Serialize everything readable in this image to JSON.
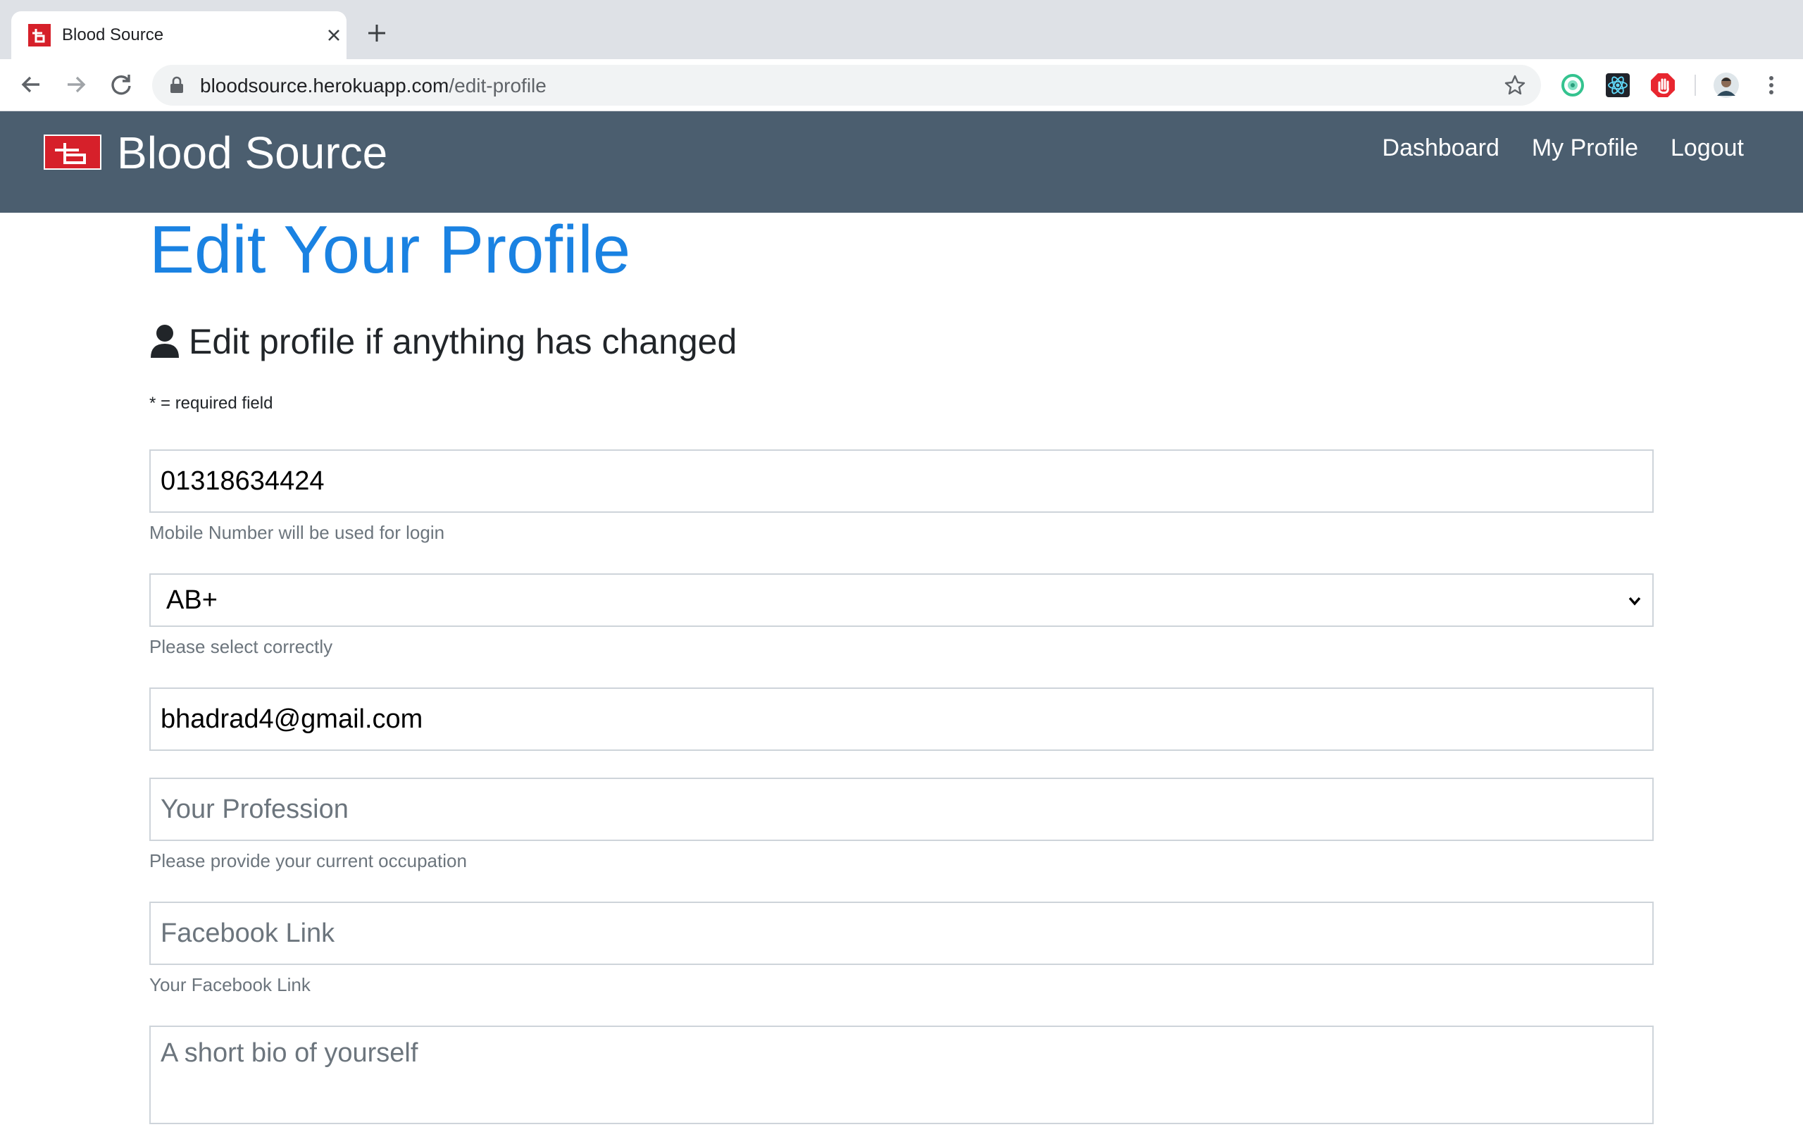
{
  "browser": {
    "tab_title": "Blood Source",
    "url_host": "bloodsource.herokuapp.com",
    "url_path": "/edit-profile"
  },
  "navbar": {
    "brand": "Blood Source",
    "links": [
      "Dashboard",
      "My Profile",
      "Logout"
    ]
  },
  "page": {
    "title": "Edit Your Profile",
    "subtitle": "Edit profile if anything has changed",
    "required_note": "* = required field"
  },
  "form": {
    "mobile": {
      "value": "01318634424",
      "hint": "Mobile Number will be used for login"
    },
    "blood_group": {
      "value": "AB+",
      "hint": "Please select correctly"
    },
    "email": {
      "value": "bhadrad4@gmail.com"
    },
    "profession": {
      "placeholder": "Your Profession",
      "hint": "Please provide your current occupation"
    },
    "facebook": {
      "placeholder": "Facebook Link",
      "hint": "Your Facebook Link"
    },
    "bio": {
      "placeholder": "A short bio of yourself"
    }
  },
  "colors": {
    "navbar_bg": "#4b5e6f",
    "title_blue": "#1a82e2",
    "brand_red": "#d6202a"
  }
}
